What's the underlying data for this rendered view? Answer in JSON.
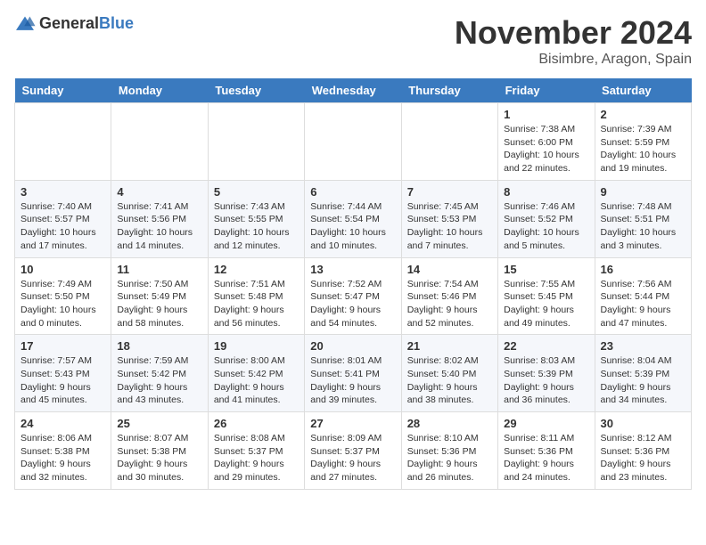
{
  "header": {
    "logo_general": "General",
    "logo_blue": "Blue",
    "month_title": "November 2024",
    "location": "Bisimbre, Aragon, Spain"
  },
  "days_of_week": [
    "Sunday",
    "Monday",
    "Tuesday",
    "Wednesday",
    "Thursday",
    "Friday",
    "Saturday"
  ],
  "weeks": [
    [
      {
        "day": "",
        "info": ""
      },
      {
        "day": "",
        "info": ""
      },
      {
        "day": "",
        "info": ""
      },
      {
        "day": "",
        "info": ""
      },
      {
        "day": "",
        "info": ""
      },
      {
        "day": "1",
        "info": "Sunrise: 7:38 AM\nSunset: 6:00 PM\nDaylight: 10 hours and 22 minutes."
      },
      {
        "day": "2",
        "info": "Sunrise: 7:39 AM\nSunset: 5:59 PM\nDaylight: 10 hours and 19 minutes."
      }
    ],
    [
      {
        "day": "3",
        "info": "Sunrise: 7:40 AM\nSunset: 5:57 PM\nDaylight: 10 hours and 17 minutes."
      },
      {
        "day": "4",
        "info": "Sunrise: 7:41 AM\nSunset: 5:56 PM\nDaylight: 10 hours and 14 minutes."
      },
      {
        "day": "5",
        "info": "Sunrise: 7:43 AM\nSunset: 5:55 PM\nDaylight: 10 hours and 12 minutes."
      },
      {
        "day": "6",
        "info": "Sunrise: 7:44 AM\nSunset: 5:54 PM\nDaylight: 10 hours and 10 minutes."
      },
      {
        "day": "7",
        "info": "Sunrise: 7:45 AM\nSunset: 5:53 PM\nDaylight: 10 hours and 7 minutes."
      },
      {
        "day": "8",
        "info": "Sunrise: 7:46 AM\nSunset: 5:52 PM\nDaylight: 10 hours and 5 minutes."
      },
      {
        "day": "9",
        "info": "Sunrise: 7:48 AM\nSunset: 5:51 PM\nDaylight: 10 hours and 3 minutes."
      }
    ],
    [
      {
        "day": "10",
        "info": "Sunrise: 7:49 AM\nSunset: 5:50 PM\nDaylight: 10 hours and 0 minutes."
      },
      {
        "day": "11",
        "info": "Sunrise: 7:50 AM\nSunset: 5:49 PM\nDaylight: 9 hours and 58 minutes."
      },
      {
        "day": "12",
        "info": "Sunrise: 7:51 AM\nSunset: 5:48 PM\nDaylight: 9 hours and 56 minutes."
      },
      {
        "day": "13",
        "info": "Sunrise: 7:52 AM\nSunset: 5:47 PM\nDaylight: 9 hours and 54 minutes."
      },
      {
        "day": "14",
        "info": "Sunrise: 7:54 AM\nSunset: 5:46 PM\nDaylight: 9 hours and 52 minutes."
      },
      {
        "day": "15",
        "info": "Sunrise: 7:55 AM\nSunset: 5:45 PM\nDaylight: 9 hours and 49 minutes."
      },
      {
        "day": "16",
        "info": "Sunrise: 7:56 AM\nSunset: 5:44 PM\nDaylight: 9 hours and 47 minutes."
      }
    ],
    [
      {
        "day": "17",
        "info": "Sunrise: 7:57 AM\nSunset: 5:43 PM\nDaylight: 9 hours and 45 minutes."
      },
      {
        "day": "18",
        "info": "Sunrise: 7:59 AM\nSunset: 5:42 PM\nDaylight: 9 hours and 43 minutes."
      },
      {
        "day": "19",
        "info": "Sunrise: 8:00 AM\nSunset: 5:42 PM\nDaylight: 9 hours and 41 minutes."
      },
      {
        "day": "20",
        "info": "Sunrise: 8:01 AM\nSunset: 5:41 PM\nDaylight: 9 hours and 39 minutes."
      },
      {
        "day": "21",
        "info": "Sunrise: 8:02 AM\nSunset: 5:40 PM\nDaylight: 9 hours and 38 minutes."
      },
      {
        "day": "22",
        "info": "Sunrise: 8:03 AM\nSunset: 5:39 PM\nDaylight: 9 hours and 36 minutes."
      },
      {
        "day": "23",
        "info": "Sunrise: 8:04 AM\nSunset: 5:39 PM\nDaylight: 9 hours and 34 minutes."
      }
    ],
    [
      {
        "day": "24",
        "info": "Sunrise: 8:06 AM\nSunset: 5:38 PM\nDaylight: 9 hours and 32 minutes."
      },
      {
        "day": "25",
        "info": "Sunrise: 8:07 AM\nSunset: 5:38 PM\nDaylight: 9 hours and 30 minutes."
      },
      {
        "day": "26",
        "info": "Sunrise: 8:08 AM\nSunset: 5:37 PM\nDaylight: 9 hours and 29 minutes."
      },
      {
        "day": "27",
        "info": "Sunrise: 8:09 AM\nSunset: 5:37 PM\nDaylight: 9 hours and 27 minutes."
      },
      {
        "day": "28",
        "info": "Sunrise: 8:10 AM\nSunset: 5:36 PM\nDaylight: 9 hours and 26 minutes."
      },
      {
        "day": "29",
        "info": "Sunrise: 8:11 AM\nSunset: 5:36 PM\nDaylight: 9 hours and 24 minutes."
      },
      {
        "day": "30",
        "info": "Sunrise: 8:12 AM\nSunset: 5:36 PM\nDaylight: 9 hours and 23 minutes."
      }
    ]
  ]
}
